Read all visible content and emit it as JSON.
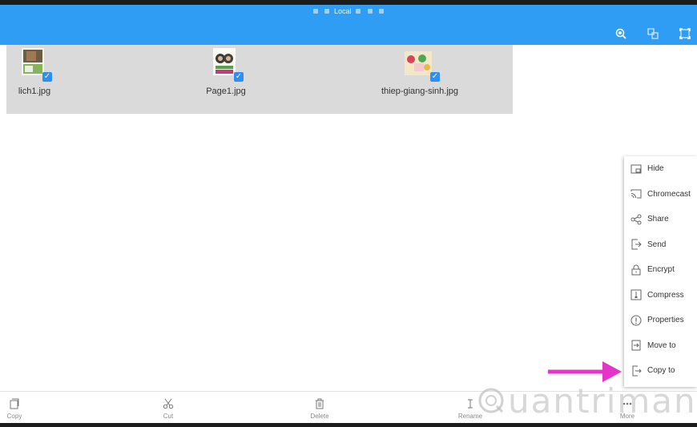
{
  "topbar": {
    "location_label": "Local",
    "action_icons": [
      "search-icon",
      "select-icon",
      "fullscreen-icon"
    ]
  },
  "files": [
    {
      "name": "lich1.jpg",
      "selected": true
    },
    {
      "name": "Page1.jpg",
      "selected": true
    },
    {
      "name": "thiep-giang-sinh.jpg",
      "selected": true
    }
  ],
  "context_menu": {
    "items": [
      {
        "label": "Hide",
        "icon": "hide-icon"
      },
      {
        "label": "Chromecast",
        "icon": "cast-icon"
      },
      {
        "label": "Share",
        "icon": "share-icon"
      },
      {
        "label": "Send",
        "icon": "send-icon"
      },
      {
        "label": "Encrypt",
        "icon": "lock-icon"
      },
      {
        "label": "Compress",
        "icon": "compress-icon"
      },
      {
        "label": "Properties",
        "icon": "info-icon"
      },
      {
        "label": "Move to",
        "icon": "move-icon"
      },
      {
        "label": "Copy to",
        "icon": "copy-to-icon"
      }
    ]
  },
  "bottom_toolbar": {
    "items": [
      {
        "label": "Copy",
        "icon": "copy-icon"
      },
      {
        "label": "Cut",
        "icon": "scissors-icon"
      },
      {
        "label": "Delete",
        "icon": "trash-icon"
      },
      {
        "label": "Rename",
        "icon": "rename-icon"
      },
      {
        "label": "More",
        "icon": "more-icon"
      }
    ]
  },
  "watermark": {
    "text": "uantrimang"
  },
  "colors": {
    "header": "#2f9df3",
    "selection_panel": "#dadada",
    "checkbox": "#2f8ff0",
    "annotation_arrow": "#e535c8"
  }
}
